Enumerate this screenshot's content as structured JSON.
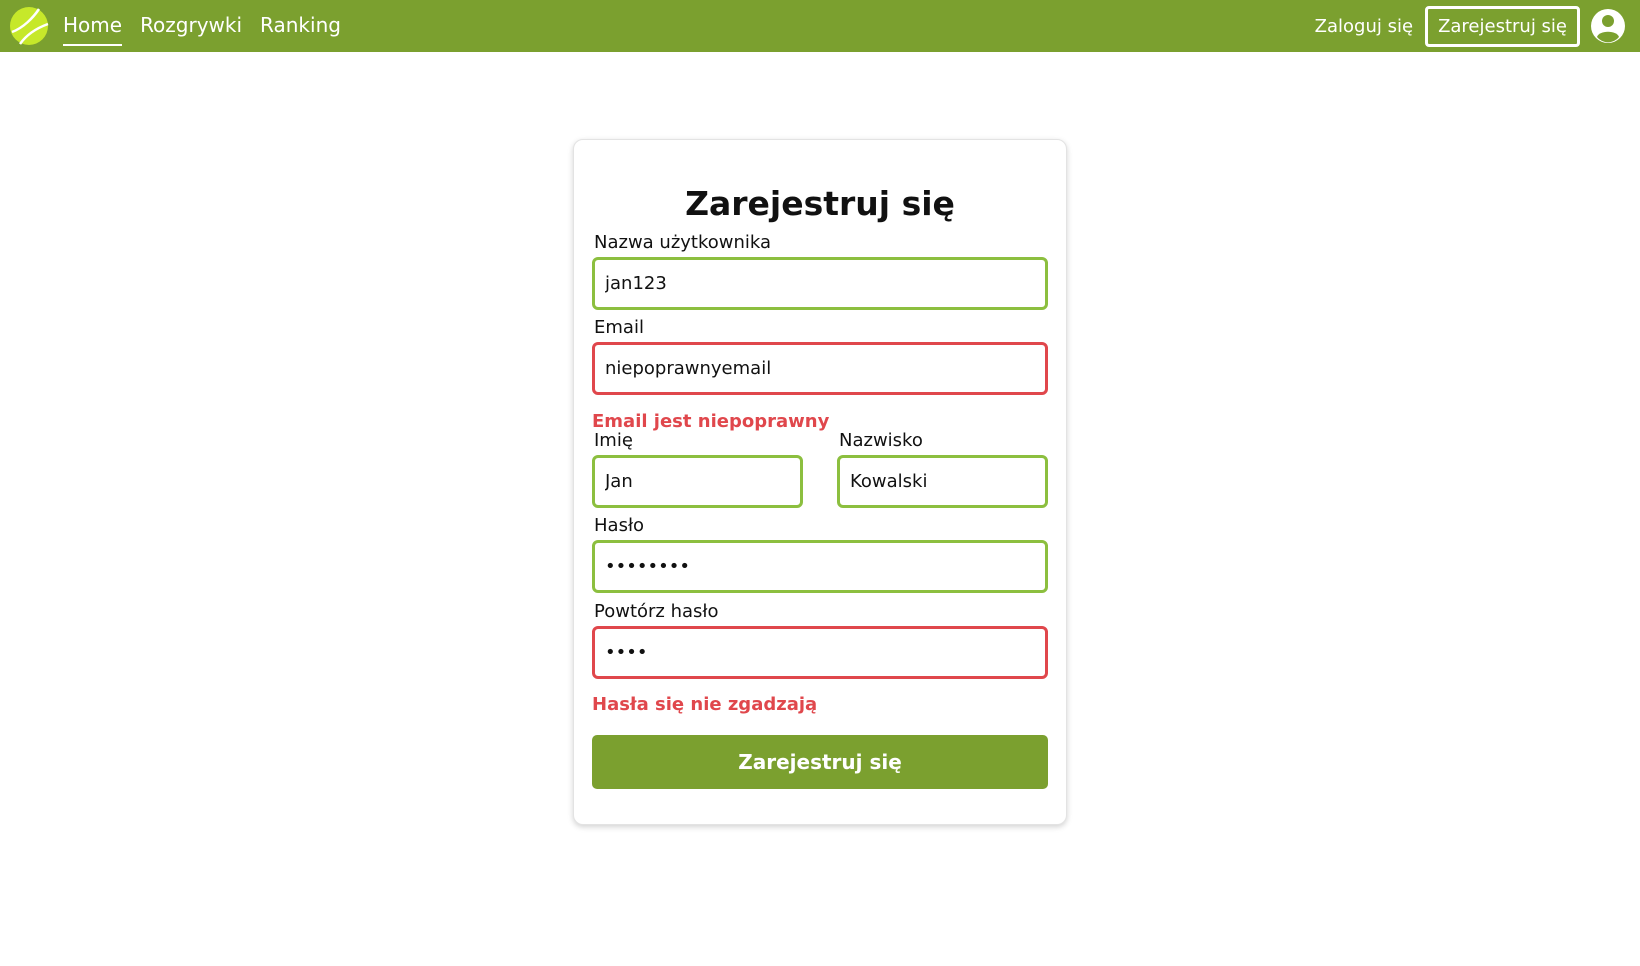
{
  "nav": {
    "links": [
      "Home",
      "Rozgrywki",
      "Ranking"
    ],
    "login_label": "Zaloguj się",
    "register_label": "Zarejestruj się"
  },
  "form": {
    "title": "Zarejestruj się",
    "username": {
      "label": "Nazwa użytkownika",
      "value": "jan123"
    },
    "email": {
      "label": "Email",
      "value": "niepoprawnyemail",
      "error": "Email jest niepoprawny"
    },
    "first_name": {
      "label": "Imię",
      "value": "Jan"
    },
    "last_name": {
      "label": "Nazwisko",
      "value": "Kowalski"
    },
    "password": {
      "label": "Hasło",
      "value": "12345678"
    },
    "password_repeat": {
      "label": "Powtórz hasło",
      "value": "1234",
      "error": "Hasła się nie zgadzają"
    },
    "submit_label": "Zarejestruj się"
  },
  "colors": {
    "brand": "#7ba02f",
    "valid_border": "#8cbf3f",
    "error": "#e0474c"
  },
  "icons": [
    "tennis-ball-logo-icon",
    "user-account-icon"
  ]
}
